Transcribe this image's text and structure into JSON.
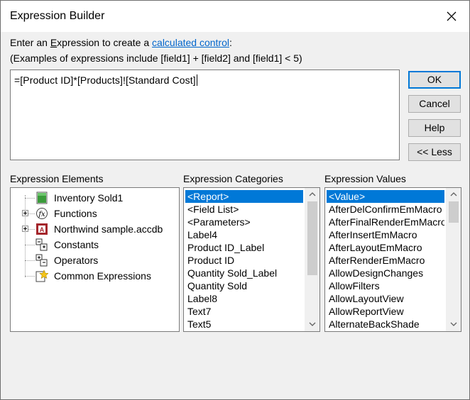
{
  "window": {
    "title": "Expression Builder"
  },
  "intro": {
    "line1_prefix": "Enter an ",
    "line1_accel": "E",
    "line1_mid": "xpression to create a ",
    "line1_link": "calculated control",
    "line1_suffix": ":",
    "line2": "(Examples of expressions include [field1] + [field2] and [field1] < 5)"
  },
  "expression": {
    "value": "=[Product ID]*[Products]![Standard Cost]"
  },
  "buttons": {
    "ok": "OK",
    "cancel": "Cancel",
    "help": "Help",
    "less": "<< Less"
  },
  "sections": {
    "elements_label": "Expression Elements",
    "categories_label": "Expression Categories",
    "values_label": "Expression Values"
  },
  "elements": [
    {
      "label": "Inventory Sold1",
      "icon": "report-icon"
    },
    {
      "label": "Functions",
      "icon": "function-icon"
    },
    {
      "label": "Northwind sample.accdb",
      "icon": "database-icon"
    },
    {
      "label": "Constants",
      "icon": "constants-icon"
    },
    {
      "label": "Operators",
      "icon": "operators-icon"
    },
    {
      "label": "Common Expressions",
      "icon": "common-expressions-icon"
    }
  ],
  "categories": [
    "<Report>",
    "<Field List>",
    "<Parameters>",
    "Label4",
    "Product ID_Label",
    "Product ID",
    "Quantity Sold_Label",
    "Quantity Sold",
    "Label8",
    "Text7",
    "Text5"
  ],
  "values": [
    "<Value>",
    "AfterDelConfirmEmMacro",
    "AfterFinalRenderEmMacro",
    "AfterInsertEmMacro",
    "AfterLayoutEmMacro",
    "AfterRenderEmMacro",
    "AllowDesignChanges",
    "AllowFilters",
    "AllowLayoutView",
    "AllowReportView",
    "AlternateBackShade"
  ],
  "colors": {
    "selection": "#0078d7",
    "link": "#0066cc",
    "focus_border": "#0078d7"
  }
}
